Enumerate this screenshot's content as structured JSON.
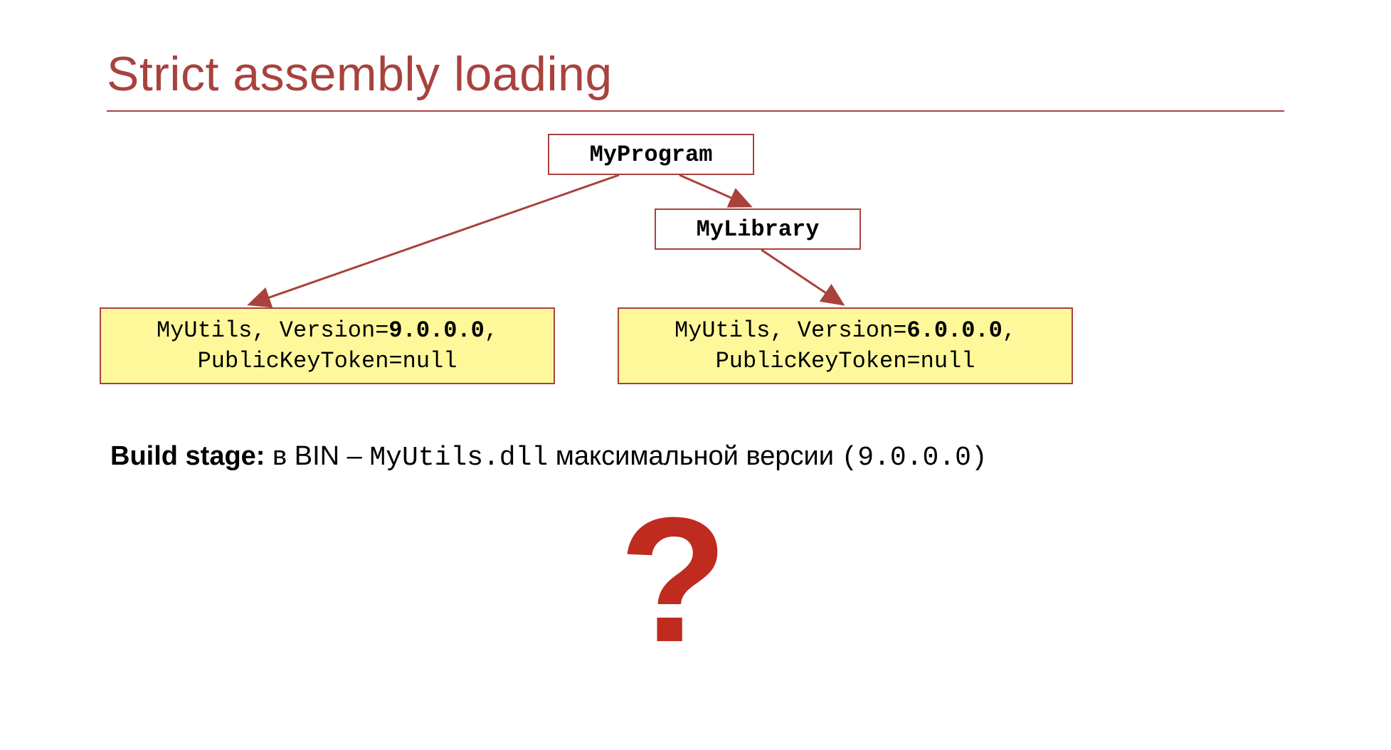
{
  "title": "Strict assembly loading",
  "boxes": {
    "myprogram": "MyProgram",
    "mylibrary": "MyLibrary"
  },
  "yellow_left": {
    "prefix": "MyUtils, Version=",
    "version": "9.0.0.0",
    "suffix": ",",
    "line2": "PublicKeyToken=null"
  },
  "yellow_right": {
    "prefix": "MyUtils, Version=",
    "version": "6.0.0.0",
    "suffix": ",",
    "line2": "PublicKeyToken=null"
  },
  "build_stage": {
    "label": "Build stage:",
    "text1": " в BIN – ",
    "code": "MyUtils.dll",
    "text2": " максимальной версии ",
    "version": "(9.0.0.0)"
  },
  "question_mark": "?"
}
